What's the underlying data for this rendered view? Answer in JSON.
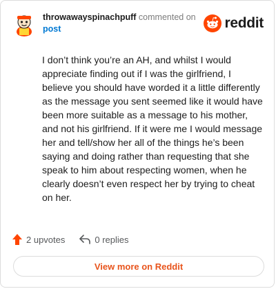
{
  "header": {
    "username": "throwawayspinachpuff",
    "action": "commented on",
    "post_link": "post",
    "brand": "reddit"
  },
  "comment": {
    "text": "I don’t think you’re an AH, and whilst I would appreciate finding out if I was the girlfriend, I believe you should have worded it a little differently as the message you sent seemed like it would have been more suitable as a message to his mother, and not his girlfriend. If it were me I would message her and tell/show her all of the things he’s been saying and doing rather than requesting that she speak to him about respecting women, when he clearly doesn’t even respect her by trying to cheat on her."
  },
  "footer": {
    "upvotes_label": "2 upvotes",
    "replies_label": "0 replies"
  },
  "view_more_label": "View more on Reddit",
  "colors": {
    "accent": "#ff4500",
    "link": "#0079d3",
    "view_more_text": "#e8541c"
  },
  "icons": {
    "avatar": "snoo-avatar-icon",
    "brand": "reddit-logo-icon",
    "upvote": "upvote-arrow-icon",
    "reply": "reply-arrow-icon"
  }
}
